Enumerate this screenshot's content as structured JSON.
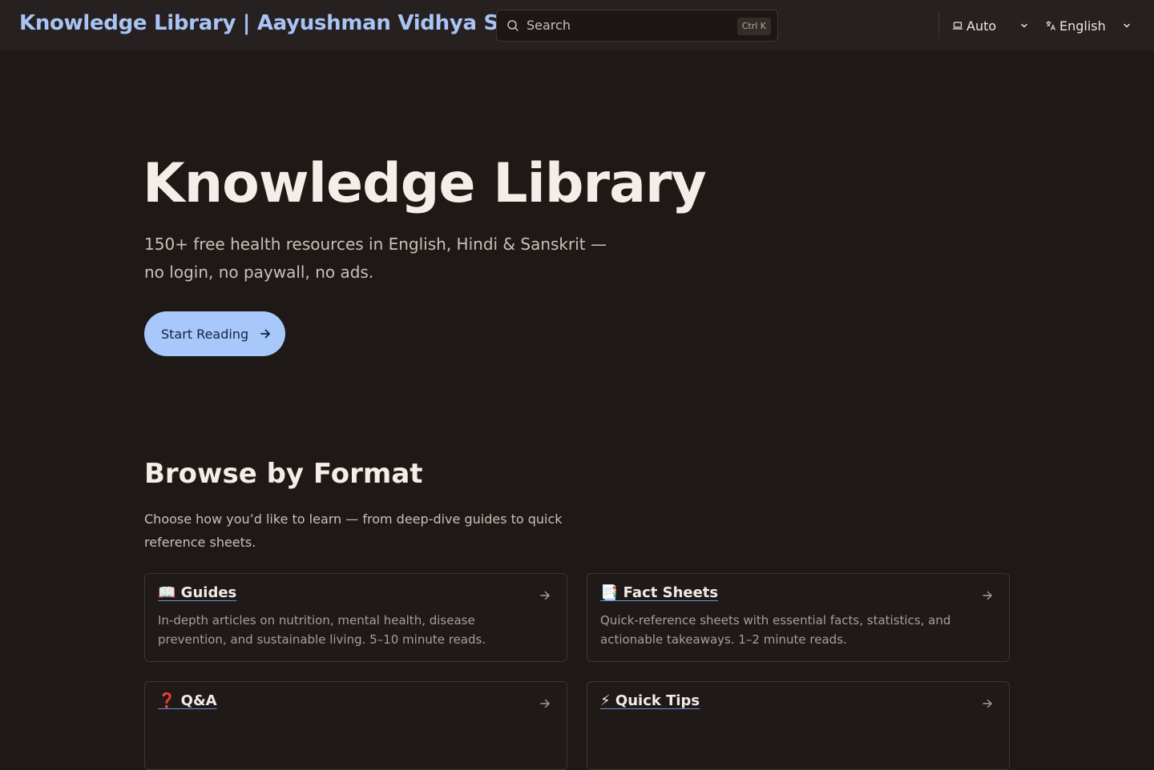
{
  "header": {
    "site_title": "Knowledge Library | Aayushman Vidhya Society",
    "search": {
      "placeholder": "Search",
      "shortcut": "Ctrl K"
    },
    "theme_select": {
      "value": "Auto"
    },
    "language_select": {
      "value": "English"
    }
  },
  "hero": {
    "title": "Knowledge Library",
    "subtitle": "150+ free health resources in English, Hindi & Sanskrit — no login, no paywall, no ads.",
    "cta_label": "Start Reading"
  },
  "browse": {
    "title": "Browse by Format",
    "subtitle": "Choose how you’d like to learn — from deep-dive guides to quick reference sheets.",
    "cards": [
      {
        "title": "📖 Guides",
        "description": "In-depth articles on nutrition, mental health, disease prevention, and sustainable living. 5–10 minute reads."
      },
      {
        "title": "📑 Fact Sheets",
        "description": "Quick-reference sheets with essential facts, statistics, and actionable takeaways. 1–2 minute reads."
      },
      {
        "title": "❓ Q&A",
        "description": ""
      },
      {
        "title": "⚡ Quick Tips",
        "description": ""
      }
    ]
  },
  "colors": {
    "background": "#1e1816",
    "header_bg": "#262120",
    "accent": "#a8c7fa",
    "title_link": "#a9c4f5"
  }
}
